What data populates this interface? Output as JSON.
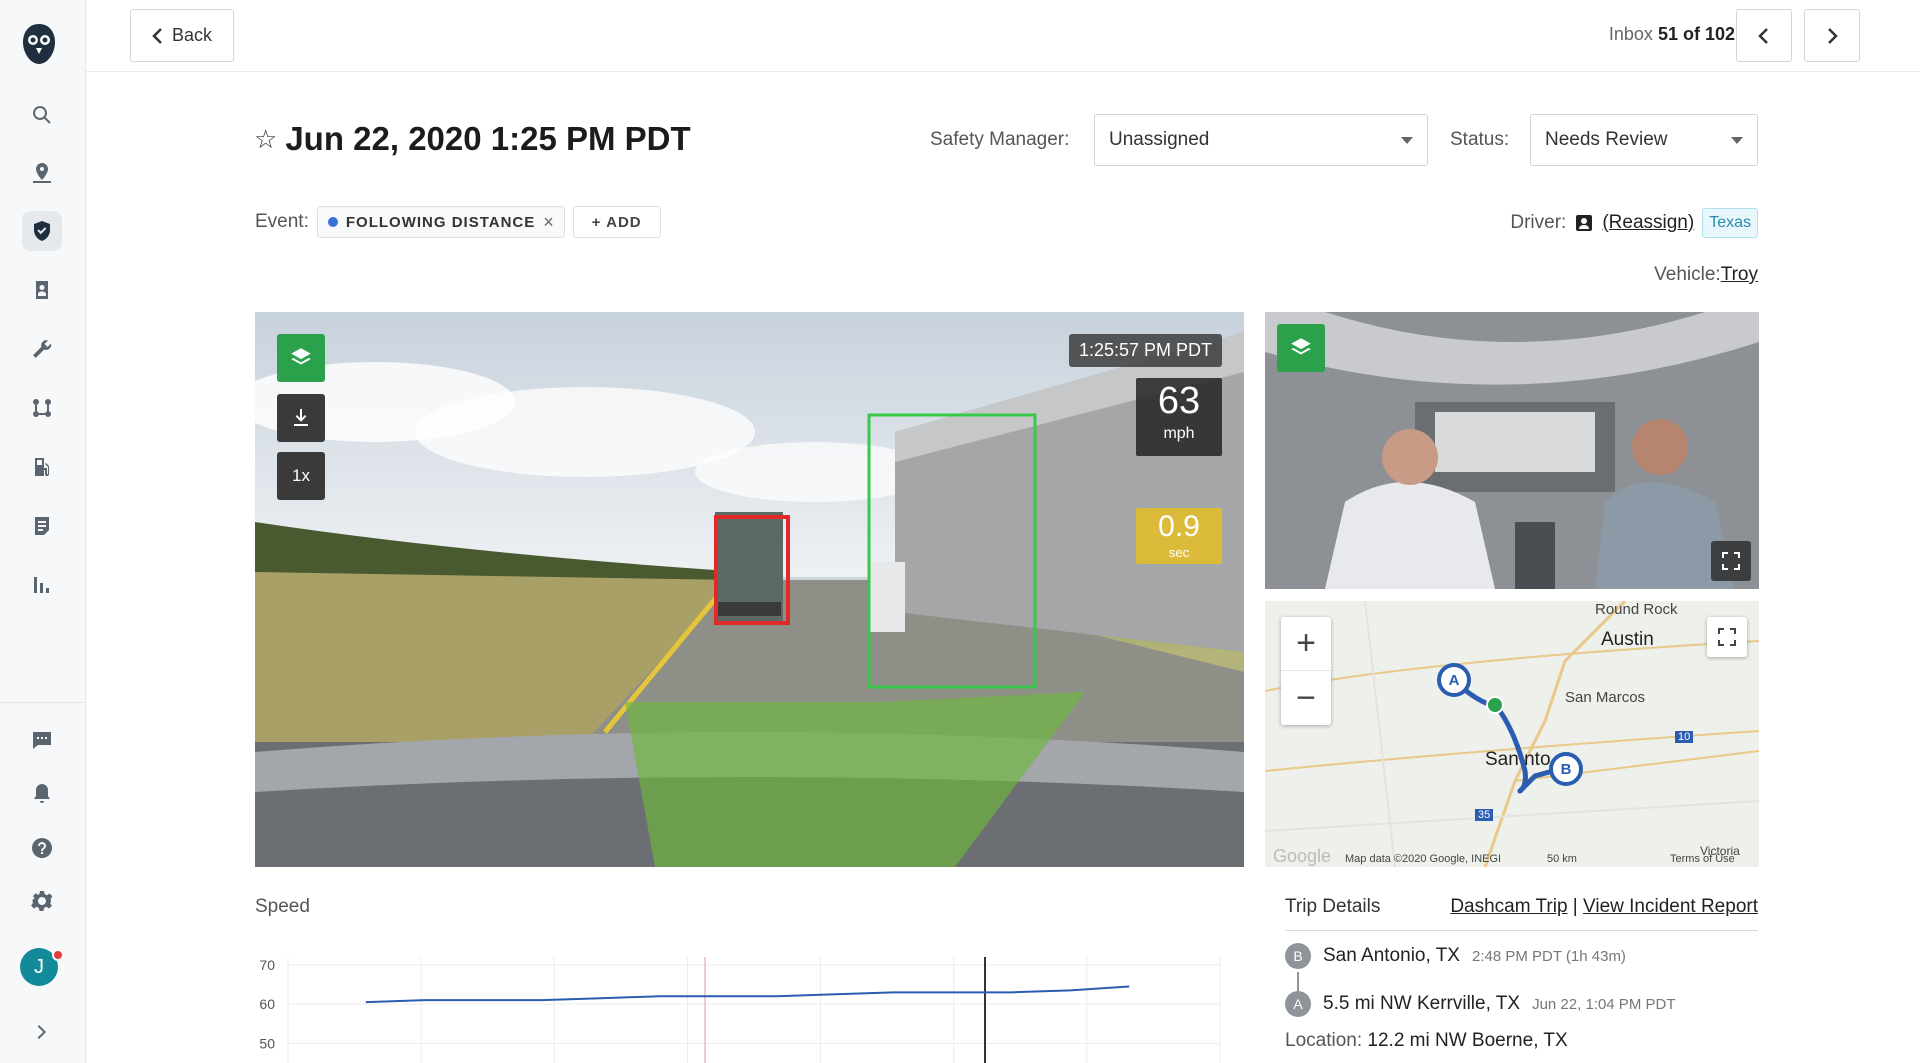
{
  "nav": {
    "back_label": "Back",
    "inbox_prefix": "Inbox",
    "inbox_position": "51 of 102"
  },
  "header": {
    "title": "Jun 22, 2020 1:25 PM PDT",
    "safety_manager_label": "Safety Manager:",
    "safety_manager_value": "Unassigned",
    "status_label": "Status:",
    "status_value": "Needs Review"
  },
  "event": {
    "label": "Event:",
    "chip": "FOLLOWING DISTANCE",
    "add_label": "+ ADD"
  },
  "driver": {
    "label": "Driver:",
    "reassign": "(Reassign)",
    "tag": "Texas",
    "vehicle_label": "Vehicle:",
    "vehicle_value": "Troy"
  },
  "video": {
    "timestamp": "1:25:57 PM PDT",
    "speed": "63",
    "speed_unit": "mph",
    "following_time": "0.9",
    "following_unit": "sec",
    "playback_rate": "1x"
  },
  "map": {
    "labels": {
      "round_rock": "Round Rock",
      "austin": "Austin",
      "san_marcos": "San Marcos",
      "san_antonio_a": "San",
      "san_antonio_b": "nt",
      "san_antonio_c": "o",
      "victoria": "Victoria"
    },
    "shields": {
      "i10": "10",
      "i35": "35"
    },
    "marker_a": "A",
    "marker_b": "B",
    "attribution": "Map data ©2020 Google, INEGI",
    "scale": "50 km",
    "terms": "Terms of Use",
    "google": "Google"
  },
  "speed_chart": {
    "title": "Speed"
  },
  "chart_data": {
    "type": "line",
    "title": "",
    "ylim": [
      45,
      72
    ],
    "yticks": [
      70,
      60,
      50
    ],
    "series": [
      {
        "values": [
          60.5,
          61,
          61,
          61,
          61.5,
          62,
          62,
          62,
          62.5,
          63,
          63,
          63,
          63.5,
          64.5
        ]
      }
    ]
  },
  "trip": {
    "title": "Trip Details",
    "dashcam_link": "Dashcam Trip",
    "separator": "|",
    "incident_link": "View Incident Report",
    "stop_b_badge": "B",
    "stop_b_place": "San Antonio, TX",
    "stop_b_time": "2:48 PM PDT (1h 43m)",
    "stop_a_badge": "A",
    "stop_a_place": "5.5 mi NW Kerrville, TX",
    "stop_a_time": "Jun 22, 1:04 PM PDT",
    "location_label": "Location:",
    "location_value": "12.2 mi NW Boerne, TX"
  },
  "user": {
    "initial": "J"
  },
  "colors": {
    "accent_green": "#2aa14a",
    "route_blue": "#2a5db0",
    "box_red": "#e02a2a",
    "box_green": "#38c94a"
  }
}
